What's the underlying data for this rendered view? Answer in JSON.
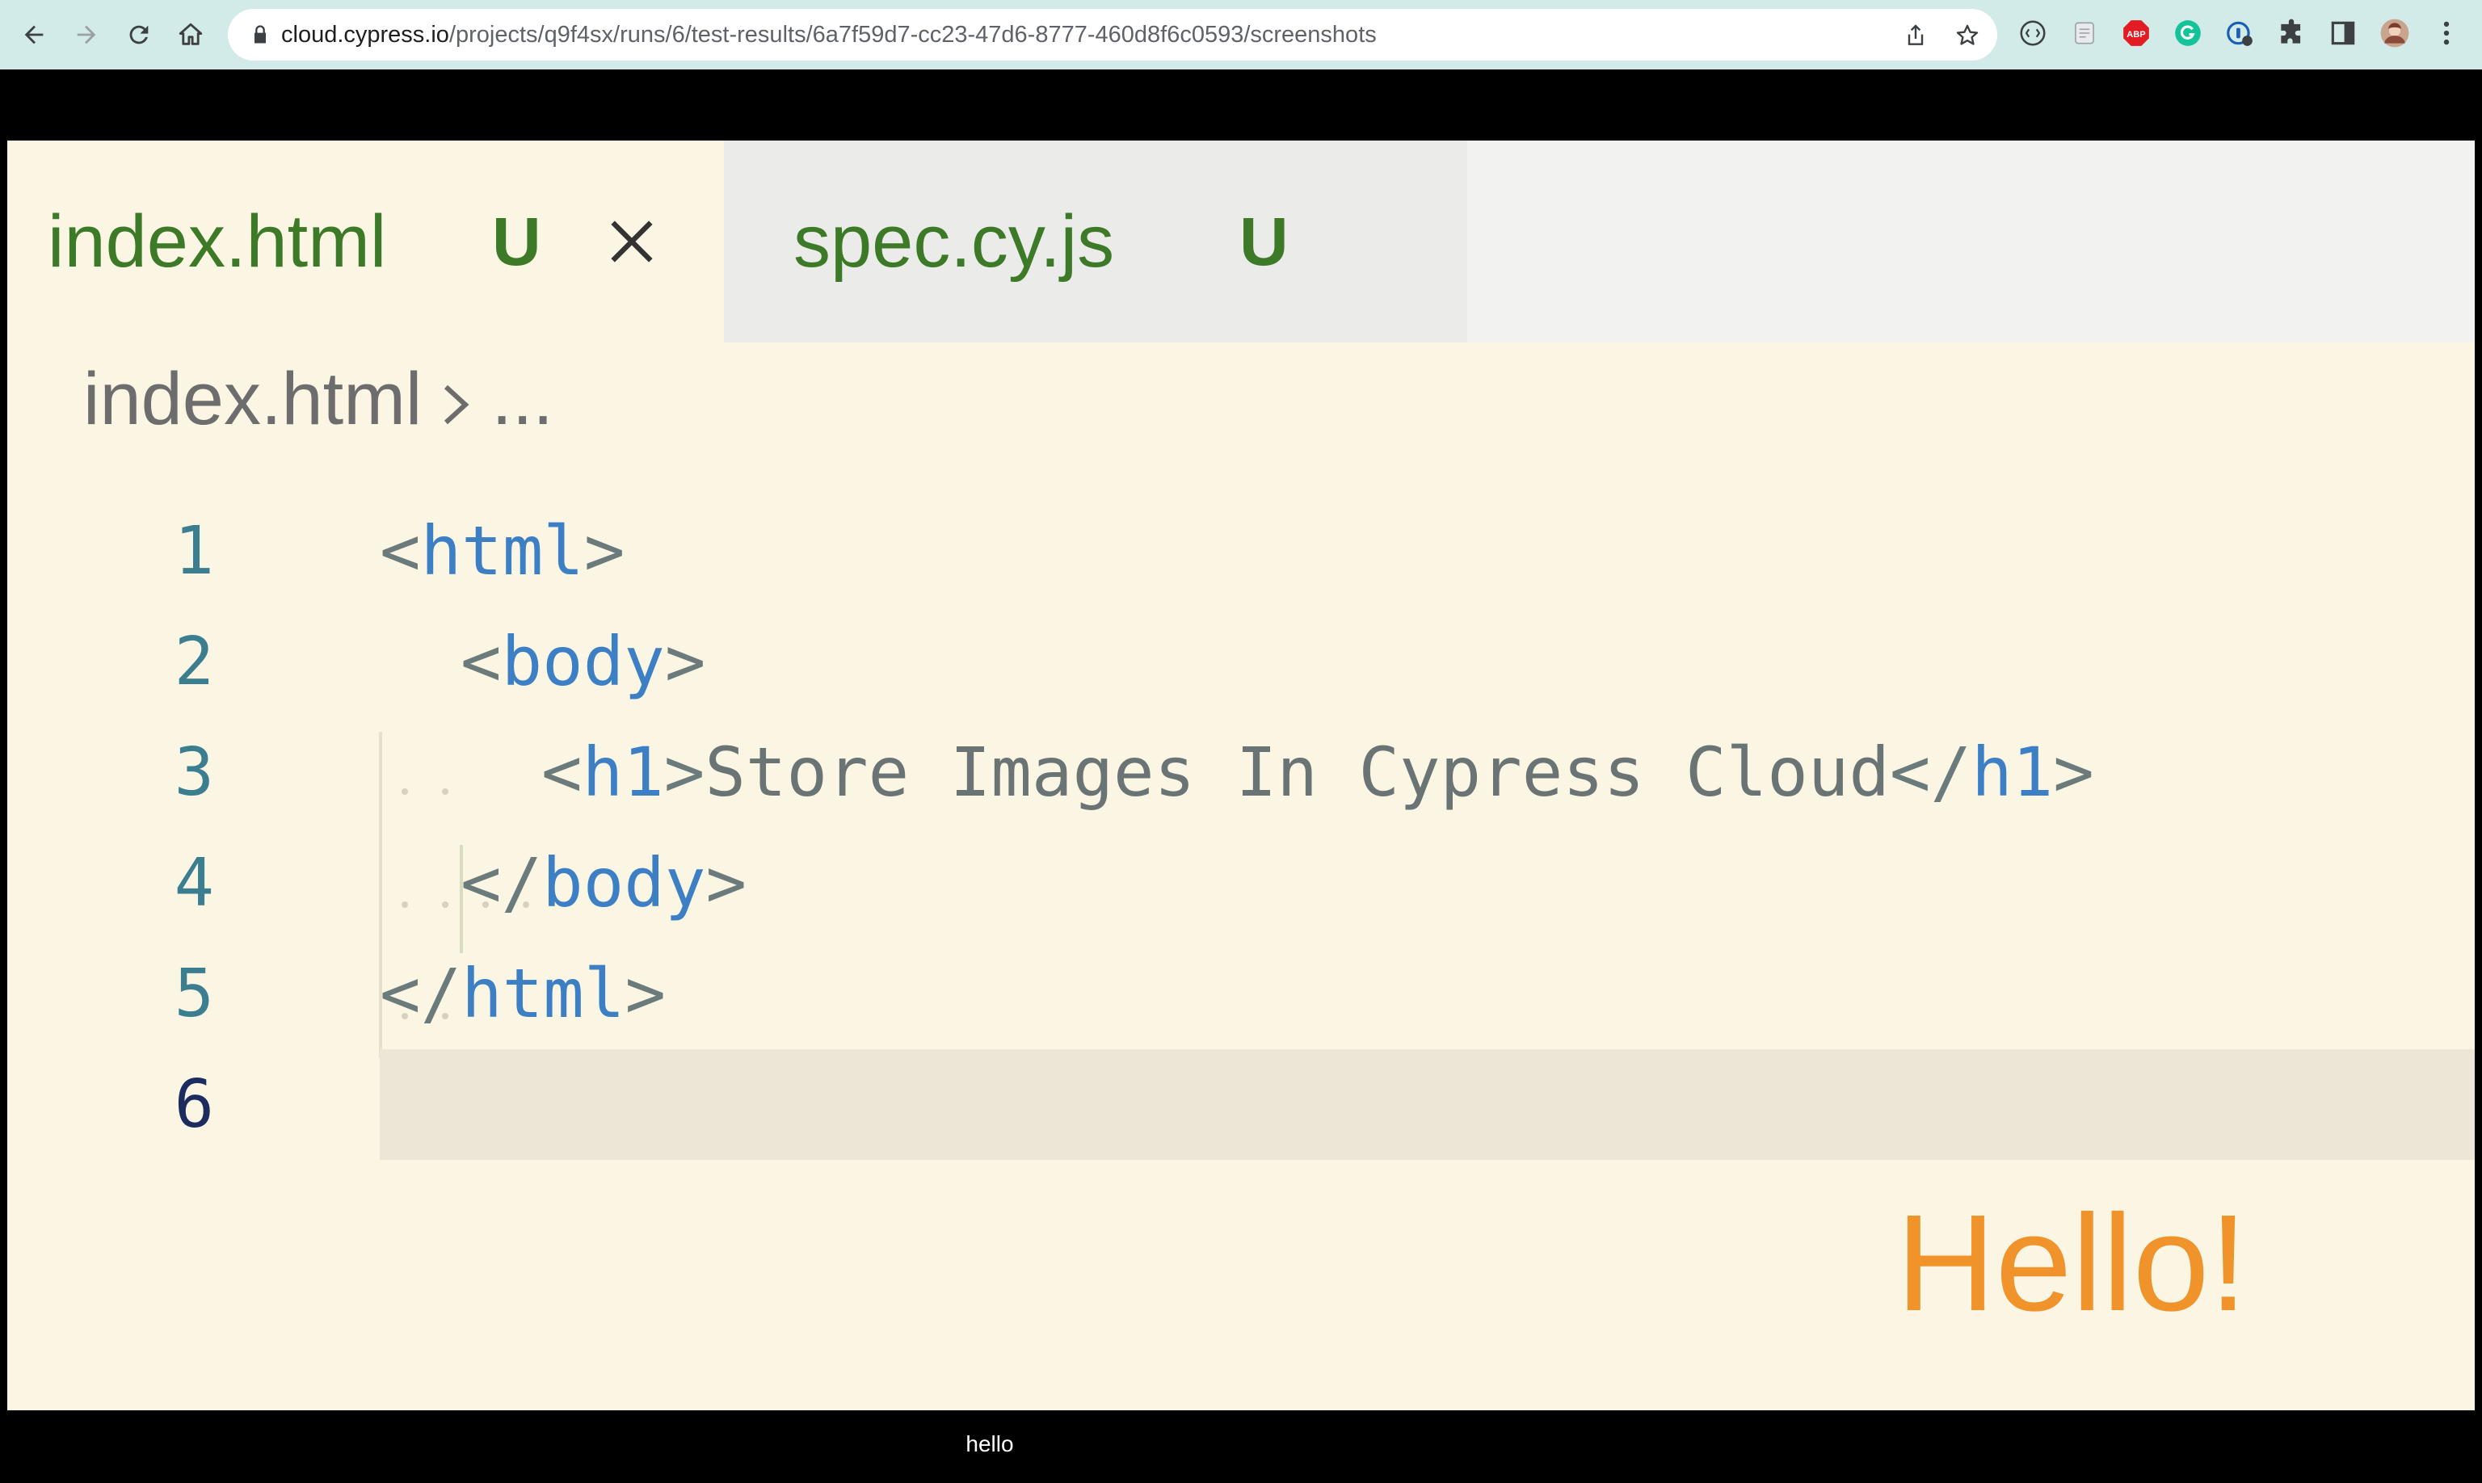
{
  "browser": {
    "url_host": "cloud.cypress.io",
    "url_path": "/projects/q9f4sx/runs/6/test-results/6a7f59d7-cc23-47d6-8777-460d8f6c0593/screenshots",
    "extensions": [
      "devtools-extension-icon",
      "notes-extension-icon",
      "adblock-extension-icon",
      "grammarly-extension-icon",
      "password-manager-extension-icon",
      "puzzle-extensions-icon",
      "sidebar-icon",
      "profile-avatar",
      "menu-icon"
    ]
  },
  "editor": {
    "tabs": [
      {
        "name": "index.html",
        "status": "U",
        "active": true
      },
      {
        "name": "spec.cy.js",
        "status": "U",
        "active": false
      }
    ],
    "breadcrumb": {
      "file": "index.html",
      "more": "..."
    },
    "lines": [
      {
        "num": "1"
      },
      {
        "num": "2"
      },
      {
        "num": "3"
      },
      {
        "num": "4"
      },
      {
        "num": "5"
      },
      {
        "num": "6"
      }
    ],
    "code": {
      "l1_open": "<",
      "l1_tag": "html",
      "l1_close": ">",
      "l2_open": "<",
      "l2_tag": "body",
      "l2_close": ">",
      "l3_open": "<",
      "l3_tag": "h1",
      "l3_mid": ">",
      "l3_text": "Store Images In Cypress Cloud",
      "l3_open2": "</",
      "l3_tag2": "h1",
      "l3_close": ">",
      "l4_open": "</",
      "l4_tag": "body",
      "l4_close": ">",
      "l5_open": "</",
      "l5_tag": "html",
      "l5_close": ">"
    },
    "overlay_text": "Hello!"
  },
  "caption": "hello",
  "colors": {
    "chrome": "#d2ebe9",
    "editor_bg": "#fbf5e4",
    "tab_text": "#3d7a27",
    "tag": "#3c7fc4",
    "hello": "#f0932b"
  }
}
